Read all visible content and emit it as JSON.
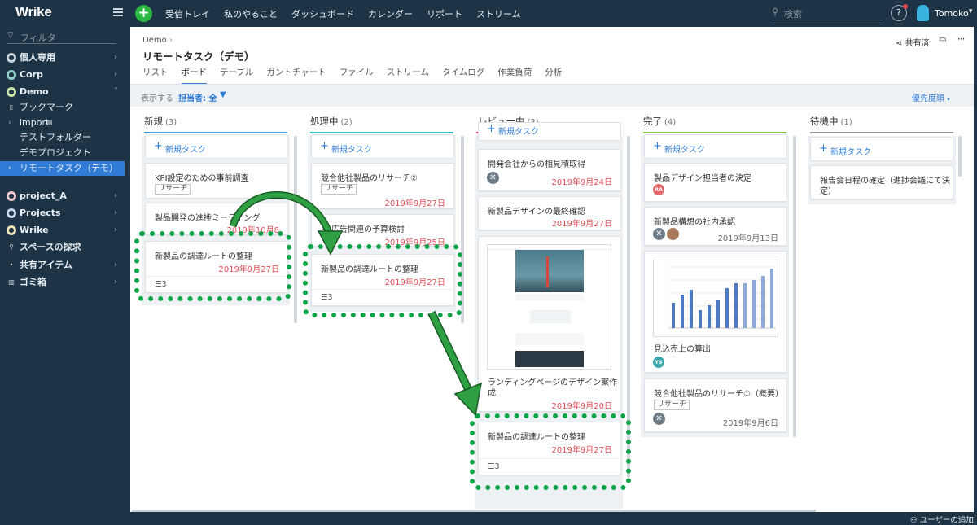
{
  "app": {
    "logo": "Wrike"
  },
  "topnav": {
    "items": [
      "受信トレイ",
      "私のやること",
      "ダッシュボード",
      "カレンダー",
      "リポート",
      "ストリーム"
    ],
    "search_placeholder": "検索",
    "help": "?",
    "user": "Tomoko"
  },
  "sidebar": {
    "filter_placeholder": "フィルタ",
    "items": [
      {
        "label": "個人専用",
        "icon": "person-space-icon"
      },
      {
        "label": "Corp",
        "icon": "corp-space-icon"
      },
      {
        "label": "Demo",
        "icon": "demo-space-icon"
      },
      {
        "label": "ブックマーク",
        "icon": "bookmark-icon"
      },
      {
        "label": "import",
        "icon": "folder-icon"
      },
      {
        "label": "テストフォルダー"
      },
      {
        "label": "デモプロジェクト"
      },
      {
        "label": "リモートタスク（デモ）"
      },
      {
        "label": "project_A",
        "icon": "project-a-space-icon"
      },
      {
        "label": "Projects",
        "icon": "projects-space-icon"
      },
      {
        "label": "Wrike",
        "icon": "wrike-space-icon"
      },
      {
        "label": "スペースの探求",
        "icon": "search-icon"
      },
      {
        "label": "共有アイテム",
        "icon": "dot-icon"
      },
      {
        "label": "ゴミ箱",
        "icon": "trash-icon"
      }
    ]
  },
  "header": {
    "breadcrumb": "Demo",
    "title": "リモートタスク（デモ）",
    "share": "共有済",
    "tabs": [
      "リスト",
      "ボード",
      "テーブル",
      "ガントチャート",
      "ファイル",
      "ストリーム",
      "タイムログ",
      "作業負荷",
      "分析"
    ],
    "active_tab": "ボード"
  },
  "toolbar": {
    "show": "表示する",
    "assignee": "担当者: 全",
    "sort": "優先度順"
  },
  "board": {
    "new_task": "新規タスク",
    "columns": [
      {
        "name": "新規",
        "count": "(3)",
        "color": "#3aa0e8"
      },
      {
        "name": "処理中",
        "count": "(2)",
        "color": "#2bc4c4"
      },
      {
        "name": "レビュー中",
        "count": "(3)",
        "color": "#e8437a"
      },
      {
        "name": "完了",
        "count": "(4)",
        "color": "#8cc63f"
      },
      {
        "name": "待機中",
        "count": "(1)",
        "color": "#999999"
      }
    ],
    "cards": {
      "c1a": {
        "title": "KPI設定のための事前調査",
        "tag": "リサーチ"
      },
      "c1b": {
        "title": "製品開発の進捗ミーティング",
        "date": "2019年10月8"
      },
      "c1c": {
        "title": "新製品の調達ルートの整理",
        "date": "2019年9月27日",
        "sub": "3"
      },
      "c2a": {
        "title": "競合他社製品のリサーチ②",
        "tag": "リサーチ",
        "date": "2019年9月27日"
      },
      "c2b": {
        "title": "PR広告関連の予算検討",
        "date": "2019年9月25日"
      },
      "c2c": {
        "title": "新製品の調達ルートの整理",
        "date": "2019年9月27日",
        "sub": "3"
      },
      "c3a": {
        "title": "開発会社からの相見積取得",
        "date": "2019年9月24日"
      },
      "c3b": {
        "title": "新製品デザインの最終確認",
        "date": "2019年9月27日"
      },
      "c3c": {
        "title": "ランディングページのデザイン案作成",
        "title1": "ランディングページのデザイン案作",
        "title2": "成",
        "date": "2019年9月20日"
      },
      "c3d": {
        "title": "新製品の調達ルートの整理",
        "date": "2019年9月27日",
        "sub": "3"
      },
      "c4a": {
        "title": "製品デザイン担当者の決定",
        "avatar": "RA"
      },
      "c4b": {
        "title": "新製品構想の社内承認",
        "date": "2019年9月13日"
      },
      "c4c": {
        "title": "見込売上の算出",
        "avatar": "YS"
      },
      "c4d": {
        "title": "競合他社製品のリサーチ①（概要）",
        "tag": "リサーチ",
        "date": "2019年9月6日"
      },
      "c5a": {
        "title1": "報告会日程の確定（進捗会議にて決",
        "title2": "定）"
      }
    }
  },
  "footer": {
    "add_user": "ユーザーの追加"
  }
}
